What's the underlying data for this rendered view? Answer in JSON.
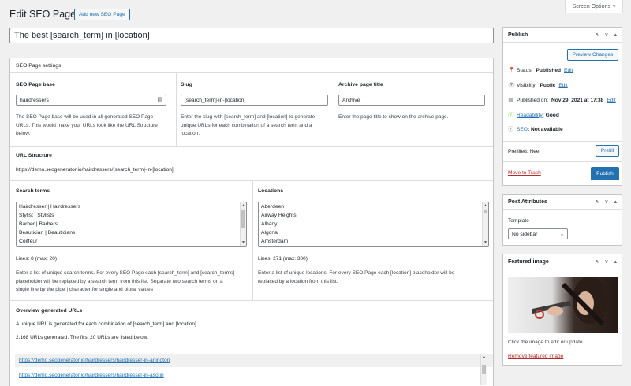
{
  "header": {
    "title": "Edit SEO Page",
    "add_new": "Add new SEO Page",
    "screen_options": "Screen Options",
    "post_title": "The best [search_term] in [location]"
  },
  "settings": {
    "heading": "SEO Page settings",
    "base": {
      "label": "SEO Page base",
      "value": "hairdressers",
      "help": [
        "The SEO Page base will be used in all generated SEO Page",
        "URLs. This would make your URLs look like the URL Structure",
        "below."
      ]
    },
    "slug": {
      "label": "Slug",
      "value": "[search_term]-in-[location]",
      "help": [
        "Enter the slug with [search_term] and [location] to generate",
        "unique URLs for each combination of a search term and a",
        "location."
      ]
    },
    "archive": {
      "label": "Archive page title",
      "value": "Archive",
      "help": [
        "Enter the page title to show on the archive page."
      ]
    },
    "url_structure": {
      "label": "URL Structure",
      "value": "https://demo.seogenerator.io/hairdressers/[search_term]-in-[location]"
    },
    "search_terms": {
      "label": "Search terms",
      "items": [
        "Hairdresser | Hairdressers",
        "Stylist | Stylists",
        "Barber | Barbers",
        "Beautician | Beauticians",
        "Coiffeur"
      ],
      "count": "Lines: 8 (max: 20)",
      "help": [
        "Enter a list of unique search terms. For every SEO Page each [search_term] and [search_terms]",
        "placeholder will be replaced by a search term from this list. Separate two search terms on a",
        "single line by the pipe | character for single and plural values"
      ]
    },
    "locations": {
      "label": "Locations",
      "items": [
        "Aberdeen",
        "Airway Heights",
        "Albany",
        "Algona",
        "Amsterdam"
      ],
      "count": "Lines: 271 (max: 300)",
      "help": [
        "Enter a list of unique locations. For every SEO Page each [location] placeholder will be",
        "replaced by a location from this list."
      ]
    },
    "overview": {
      "label": "Overview generated URLs",
      "desc": "A unique URL is generated for each combination of [search_term] and [location].",
      "generated": "2.168 URLs generated. The first 20 URLs are listed below.",
      "urls": [
        "https://demo.seogenerator.io/hairdressers/hairdresser-in-arlington",
        "https://demo.seogenerator.io/hairdressers/hairdresser-in-asotin"
      ]
    }
  },
  "publish": {
    "title": "Publish",
    "preview": "Preview Changes",
    "status_label": "Status:",
    "status_value": "Published",
    "visibility_label": "Visibility:",
    "visibility_value": "Public",
    "published_label": "Published on:",
    "published_value": "Nov 29, 2021 at 17:38",
    "edit": "Edit",
    "readability_link": "Readability",
    "readability_value": ": Good",
    "seo_link": "SEO",
    "seo_value": ": Not available",
    "prefilled": "Prefilled: Nee",
    "prefill_btn": "Prefill",
    "trash": "Move to Trash",
    "publish_btn": "Publish"
  },
  "attributes": {
    "title": "Post Attributes",
    "template_label": "Template",
    "template_value": "No sidebar"
  },
  "featured": {
    "title": "Featured image",
    "hint": "Click the image to edit or update",
    "remove": "Remove featured image"
  },
  "colors": {
    "accent": "#2271b1",
    "background": "#f0f0f1",
    "border": "#c3c4c7"
  },
  "icons": {
    "status": "pin-icon",
    "visibility": "eye-icon",
    "calendar": "calendar-icon",
    "readability": "yoast-readability-icon",
    "seo": "yoast-seo-icon"
  }
}
